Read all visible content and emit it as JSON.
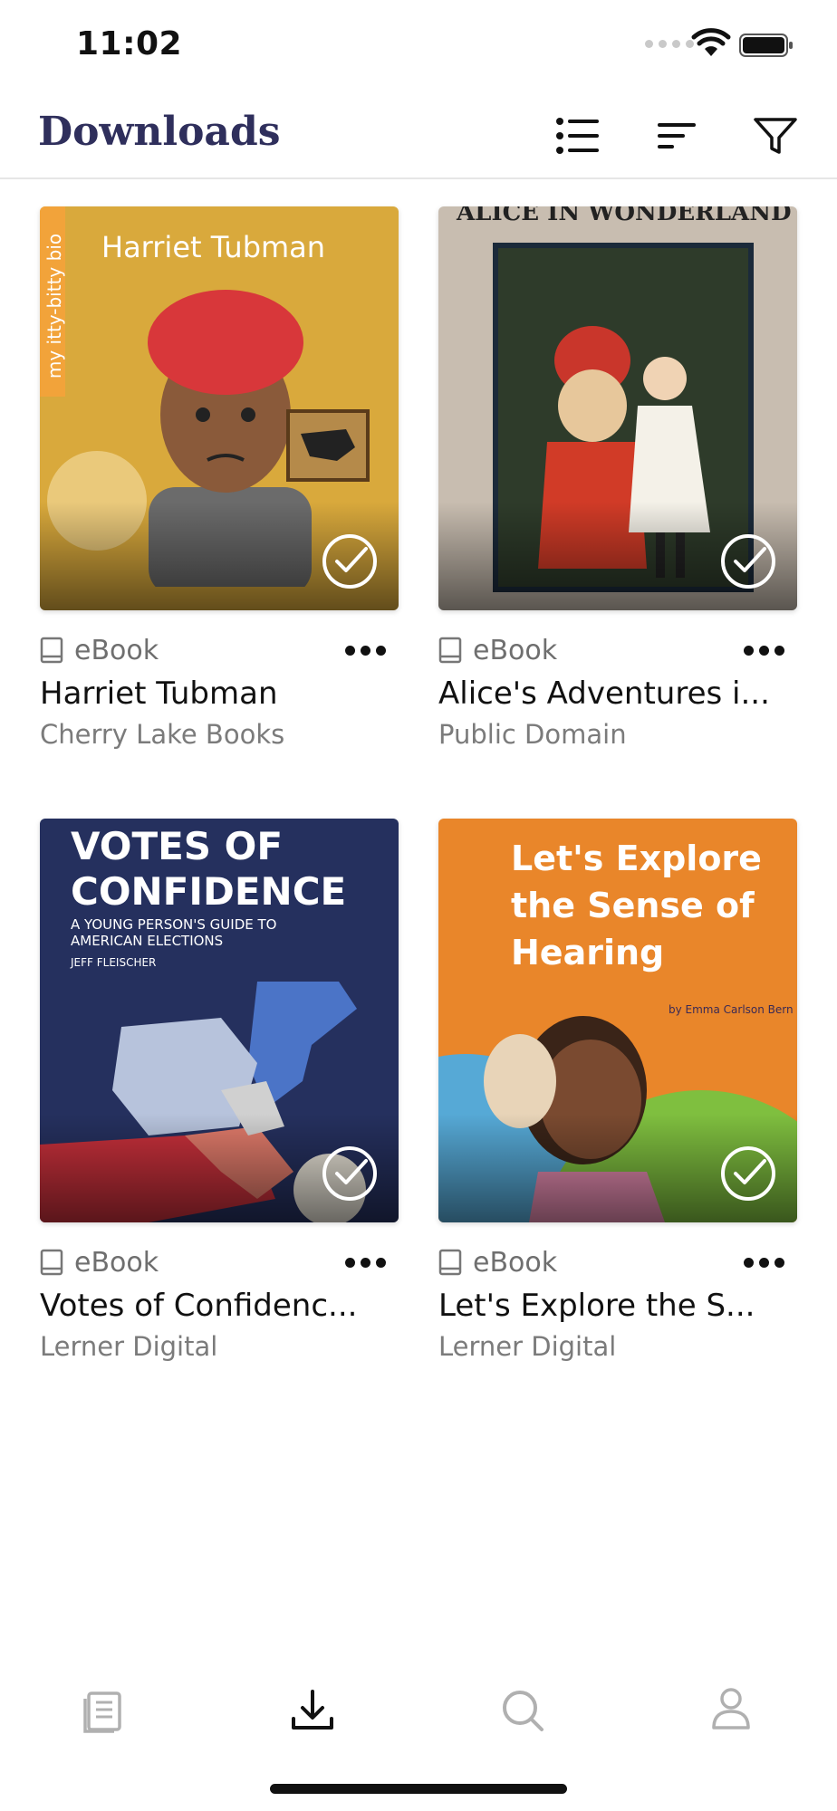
{
  "status": {
    "time": "11:02"
  },
  "header": {
    "title": "Downloads"
  },
  "books": [
    {
      "format": "eBook",
      "title": "Harriet Tubman",
      "publisher": "Cherry Lake Books",
      "cover_text": "Harriet Tubman",
      "cover_series": "my itty-bitty bio",
      "cover_color": "#d9a93c"
    },
    {
      "format": "eBook",
      "title": "Alice's Adventures i...",
      "publisher": "Public Domain",
      "cover_text": "ALICE IN WONDERLAND",
      "cover_color": "#c8bdb0"
    },
    {
      "format": "eBook",
      "title": "Votes of Confidenc...",
      "publisher": "Lerner Digital",
      "cover_text": "VOTES OF CONFIDENCE",
      "cover_subtitle": "A YOUNG PERSON'S GUIDE TO AMERICAN ELECTIONS",
      "cover_author": "JEFF FLEISCHER",
      "cover_color": "#25305e"
    },
    {
      "format": "eBook",
      "title": "Let's Explore the S...",
      "publisher": "Lerner Digital",
      "cover_text": "Let's Explore the Sense of Hearing",
      "cover_author": "by Emma Carlson Bern",
      "cover_color": "#e9862a"
    }
  ],
  "tabs": [
    {
      "name": "library",
      "icon": "library-icon",
      "active": false
    },
    {
      "name": "downloads",
      "icon": "download-icon",
      "active": true
    },
    {
      "name": "search",
      "icon": "search-icon",
      "active": false
    },
    {
      "name": "profile",
      "icon": "person-icon",
      "active": false
    }
  ],
  "colors": {
    "title": "#2f2f5c",
    "inactive_icon": "#b0b0b0"
  }
}
